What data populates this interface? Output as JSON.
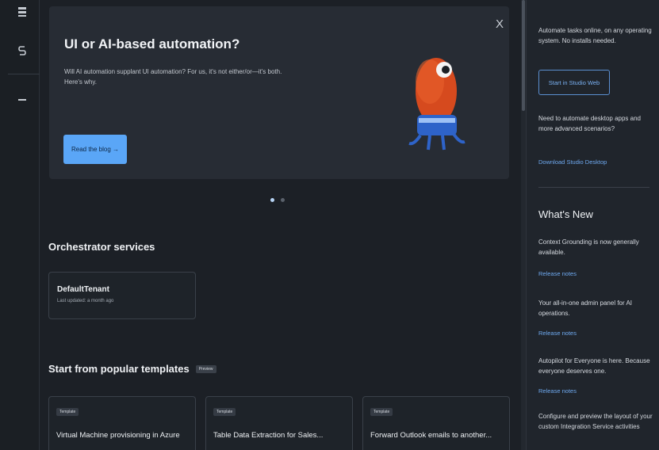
{
  "rail": {
    "icons": [
      "grid-icon",
      "dollar-icon",
      "dash-icon"
    ]
  },
  "banner": {
    "title": "UI or AI-based automation?",
    "text": "Will AI automation supplant UI automation? For us, it's not either/or—it's both. Here's why.",
    "button_label": "Read the blog →",
    "close_glyph": "X"
  },
  "carousel": {
    "count": 2,
    "active": 0
  },
  "orchestrator": {
    "title": "Orchestrator services",
    "tenant_name": "DefaultTenant",
    "tenant_updated": "Last updated: a month ago"
  },
  "templates": {
    "title": "Start from popular templates",
    "badge": "Preview",
    "items": [
      {
        "badge": "Template",
        "name": "Virtual Machine provisioning in Azure"
      },
      {
        "badge": "Template",
        "name": "Table Data Extraction for Sales..."
      },
      {
        "badge": "Template",
        "name": "Forward Outlook emails to another..."
      }
    ]
  },
  "right": {
    "intro": "Automate tasks online, on any operating system. No installs needed.",
    "studio_web_button": "Start in Studio Web",
    "desktop_text": "Need to automate desktop apps and more advanced scenarios?",
    "download_link": "Download Studio Desktop",
    "whats_new_title": "What's New",
    "news": [
      {
        "text": "Context Grounding is now generally available.",
        "link": "Release notes"
      },
      {
        "text": "Your all-in-one admin panel for AI operations.",
        "link": "Release notes"
      },
      {
        "text": "Autopilot for Everyone is here. Because everyone deserves one.",
        "link": "Release notes"
      },
      {
        "text": "Configure and preview the layout of your custom Integration Service activities",
        "link": ""
      }
    ]
  },
  "colors": {
    "accent": "#5aa6f7",
    "link": "#6ea9ef",
    "background": "#1c2026",
    "card": "#272c34"
  }
}
